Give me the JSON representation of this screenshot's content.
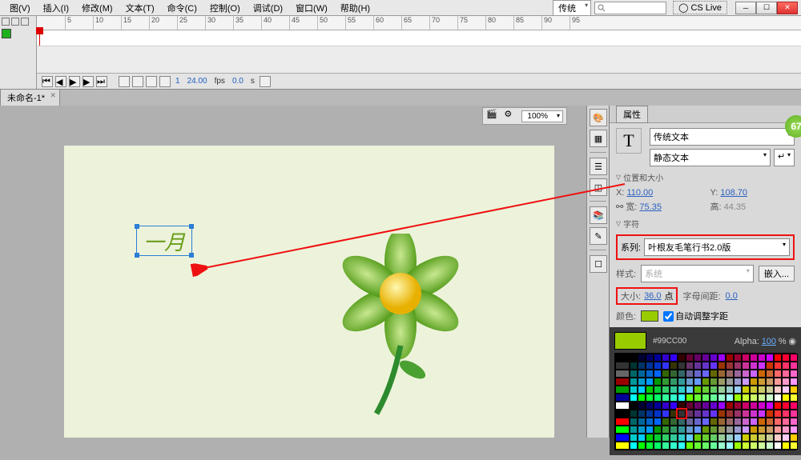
{
  "menu": {
    "view": "图(V)",
    "insert": "插入(I)",
    "modify": "修改(M)",
    "text": "文本(T)",
    "commands": "命令(C)",
    "control": "控制(O)",
    "debug": "调试(D)",
    "window": "窗口(W)",
    "help": "帮助(H)",
    "layout": "传统",
    "cslive": "CS Live"
  },
  "timeline": {
    "fps_val": "24.00",
    "fps_lbl": "fps",
    "time_val": "0.0",
    "time_lbl": "s",
    "frame": "1"
  },
  "doc": {
    "tab": "未命名-1*"
  },
  "stage": {
    "zoom": "100%",
    "text": "一月"
  },
  "badge": "67",
  "prop": {
    "title": "属性",
    "text_engine": "传统文本",
    "text_type": "静态文本",
    "sect_pos": "位置和大小",
    "x_lbl": "X:",
    "x": "110.00",
    "y_lbl": "Y:",
    "y": "108.70",
    "w_lbl": "宽:",
    "w": "75.35",
    "h_lbl": "高:",
    "h": "44.35",
    "sect_char": "字符",
    "family_lbl": "系列:",
    "family": "叶根友毛笔行书2.0版",
    "style_lbl": "样式:",
    "style": "系统",
    "embed": "嵌入...",
    "size_lbl": "大小:",
    "size": "36.0",
    "size_unit": "点",
    "spacing_lbl": "字母间距:",
    "spacing": "0.0",
    "color_lbl": "颜色:",
    "autokern": "自动调整字距",
    "hex": "#99CC00",
    "alpha_lbl": "Alpha:",
    "alpha": "100",
    "pct": "%"
  }
}
